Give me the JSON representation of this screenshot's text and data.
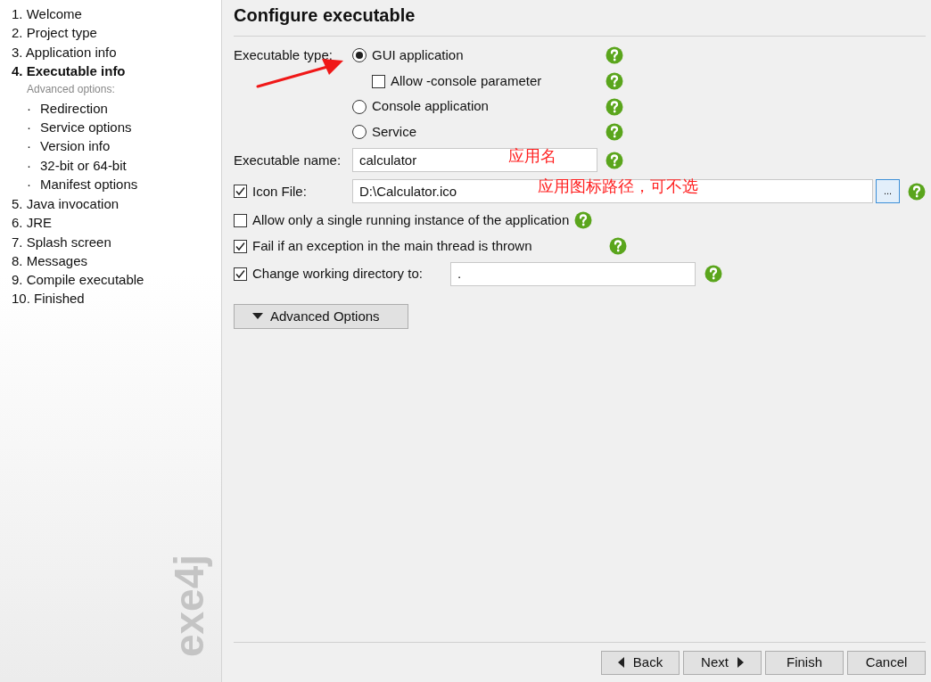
{
  "sidebar": {
    "steps": [
      {
        "label": "1. Welcome",
        "selected": false
      },
      {
        "label": "2. Project type",
        "selected": false
      },
      {
        "label": "3. Application info",
        "selected": false
      },
      {
        "label": "4. Executable info",
        "selected": true,
        "sub_heading": "Advanced options:",
        "children": [
          {
            "marker": "·",
            "label": "Redirection"
          },
          {
            "marker": "·",
            "label": "Service options"
          },
          {
            "marker": "·",
            "label": "Version info"
          },
          {
            "marker": "·",
            "label": "32-bit or 64-bit"
          },
          {
            "marker": "·",
            "label": "Manifest options"
          }
        ]
      },
      {
        "label": "5. Java invocation",
        "selected": false
      },
      {
        "label": "6. JRE",
        "selected": false
      },
      {
        "label": "7. Splash screen",
        "selected": false
      },
      {
        "label": "8. Messages",
        "selected": false
      },
      {
        "label": "9. Compile executable",
        "selected": false
      },
      {
        "label": "10. Finished",
        "selected": false
      }
    ],
    "logo": "exe4j"
  },
  "title": "Configure executable",
  "executable_type": {
    "label": "Executable type:",
    "options": [
      {
        "kind": "radio",
        "label": "GUI application",
        "selected": true
      },
      {
        "kind": "checkbox",
        "label": "Allow -console parameter",
        "checked": false
      },
      {
        "kind": "radio",
        "label": "Console application",
        "selected": false
      },
      {
        "kind": "radio",
        "label": "Service",
        "selected": false
      }
    ]
  },
  "executable_name": {
    "label": "Executable name:",
    "value": "calculator",
    "annotation": "应用名"
  },
  "icon_file": {
    "label": "Icon File:",
    "checked": true,
    "value": "D:\\Calculator.ico",
    "annotation": "应用图标路径，可不选",
    "browse": "..."
  },
  "options": [
    {
      "label": "Allow only a single running instance of the application",
      "checked": false
    },
    {
      "label": "Fail if an exception in the main thread is thrown",
      "checked": true
    }
  ],
  "working_dir": {
    "label": "Change working directory to:",
    "checked": true,
    "value": "."
  },
  "advanced_button": "Advanced Options",
  "buttons": [
    {
      "kind": "back",
      "label": "Back"
    },
    {
      "kind": "next",
      "label": "Next"
    },
    {
      "kind": "plain",
      "label": "Finish"
    },
    {
      "kind": "plain",
      "label": "Cancel"
    }
  ]
}
